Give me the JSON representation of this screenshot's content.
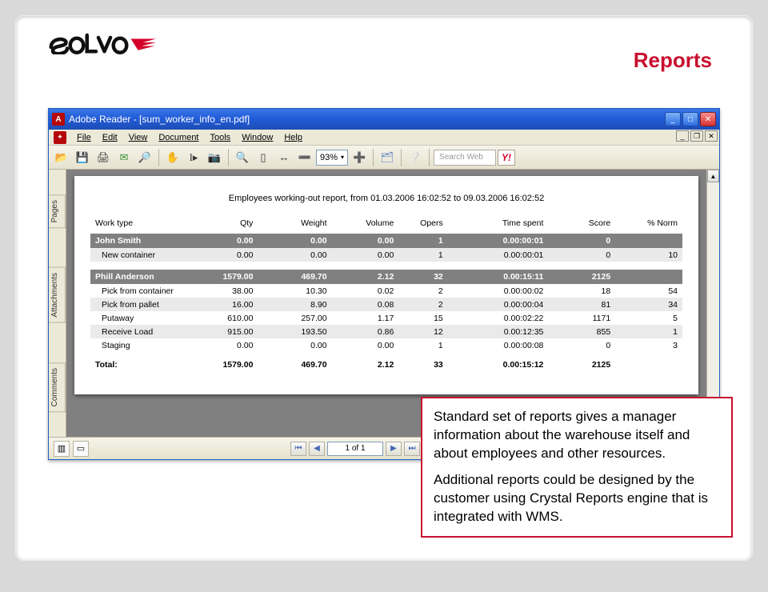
{
  "slide": {
    "title": "Reports"
  },
  "window": {
    "title": "Adobe Reader - [sum_worker_info_en.pdf]",
    "menus": [
      "File",
      "Edit",
      "View",
      "Document",
      "Tools",
      "Window",
      "Help"
    ],
    "zoom": "93%",
    "search_placeholder": "Search Web",
    "side_tabs": [
      "Pages",
      "Attachments",
      "Comments"
    ],
    "page_indicator": "1 of 1"
  },
  "report": {
    "title": "Employees working-out report, from 01.03.2006  16:02:52 to 09.03.2006  16:02:52",
    "columns": [
      "Work type",
      "Qty",
      "Weight",
      "Volume",
      "Opers",
      "Time spent",
      "Score",
      "% Norm"
    ],
    "groups": [
      {
        "name": "John Smith",
        "totals": [
          "0.00",
          "0.00",
          "0.00",
          "1",
          "0.00:00:01",
          "0",
          ""
        ],
        "rows": [
          {
            "cols": [
              "New container",
              "0.00",
              "0.00",
              "0.00",
              "1",
              "0.00:00:01",
              "0",
              "10"
            ]
          }
        ]
      },
      {
        "name": "Phill Anderson",
        "totals": [
          "1579.00",
          "469.70",
          "2.12",
          "32",
          "0.00:15:11",
          "2125",
          ""
        ],
        "rows": [
          {
            "cols": [
              "Pick from container",
              "38.00",
              "10.30",
              "0.02",
              "2",
              "0.00:00:02",
              "18",
              "54"
            ]
          },
          {
            "cols": [
              "Pick from pallet",
              "16.00",
              "8.90",
              "0.08",
              "2",
              "0.00:00:04",
              "81",
              "34"
            ]
          },
          {
            "cols": [
              "Putaway",
              "610.00",
              "257.00",
              "1.17",
              "15",
              "0.00:02:22",
              "1171",
              "5"
            ]
          },
          {
            "cols": [
              "Receive Load",
              "915.00",
              "193.50",
              "0.86",
              "12",
              "0.00:12:35",
              "855",
              "1"
            ]
          },
          {
            "cols": [
              "Staging",
              "0.00",
              "0.00",
              "0.00",
              "1",
              "0.00:00:08",
              "0",
              "3"
            ]
          }
        ]
      }
    ],
    "grand_total": [
      "Total:",
      "1579.00",
      "469.70",
      "2.12",
      "33",
      "0.00:15:12",
      "2125",
      ""
    ]
  },
  "callout": {
    "p1": "Standard set of reports gives a manager information about the warehouse itself and about employees and other resources.",
    "p2": "Additional reports could be designed by the customer using Crystal Reports engine that is integrated with WMS."
  }
}
